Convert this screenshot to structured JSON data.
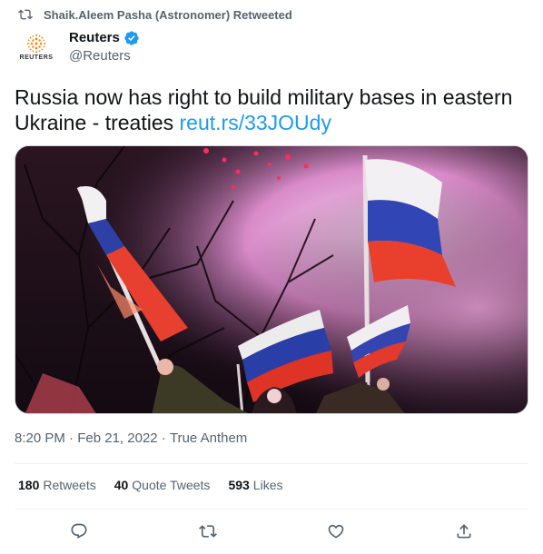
{
  "retweet": {
    "icon": "retweet-icon",
    "text": "Shaik.Aleem Pasha (Astronomer) Retweeted"
  },
  "author": {
    "name": "Reuters",
    "handle": "@Reuters",
    "avatar_label": "REUTERS",
    "verified": true,
    "brand_color": "#ff8000"
  },
  "tweet": {
    "text": "Russia now has right to build military bases in eastern Ukraine - treaties ",
    "link": "reut.rs/33JOUdy",
    "link_color": "#1d9bf0"
  },
  "media": {
    "kind": "photo",
    "subject": "russian-flags-crowd-smoke"
  },
  "meta": {
    "time": "8:20 PM",
    "separator": " · ",
    "date": "Feb 21, 2022",
    "source": "True Anthem"
  },
  "stats": {
    "retweets_count": "180",
    "retweets_label": "Retweets",
    "quotes_count": "40",
    "quotes_label": "Quote Tweets",
    "likes_count": "593",
    "likes_label": "Likes"
  },
  "actions": [
    {
      "name": "reply-icon"
    },
    {
      "name": "retweet-icon"
    },
    {
      "name": "like-icon"
    },
    {
      "name": "share-icon"
    }
  ]
}
